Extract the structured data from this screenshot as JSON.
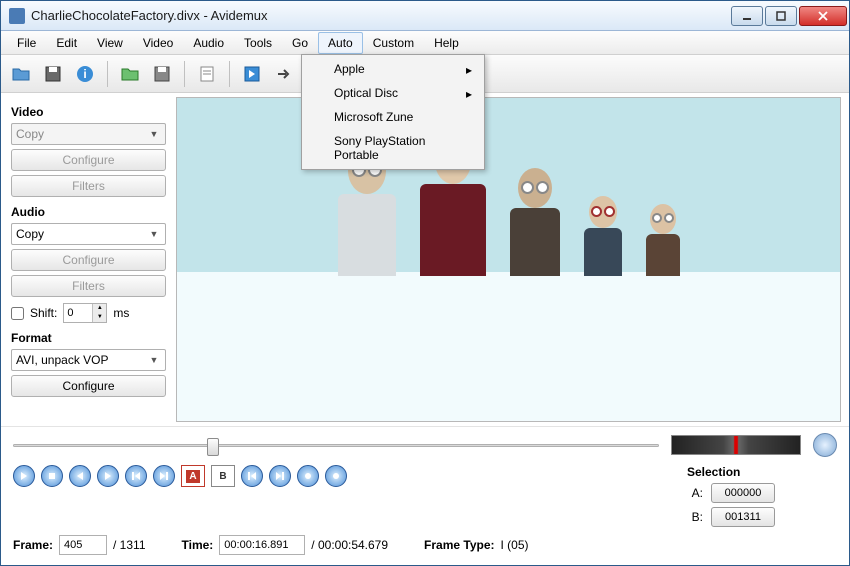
{
  "window": {
    "title": "CharlieChocolateFactory.divx - Avidemux"
  },
  "menu": {
    "items": [
      "File",
      "Edit",
      "View",
      "Video",
      "Audio",
      "Tools",
      "Go",
      "Auto",
      "Custom",
      "Help"
    ],
    "open_index": 7
  },
  "auto_menu": {
    "items": [
      {
        "label": "Apple",
        "submenu": true
      },
      {
        "label": "Optical Disc",
        "submenu": true
      },
      {
        "label": "Microsoft Zune",
        "submenu": false
      },
      {
        "label": "Sony PlayStation Portable",
        "submenu": false
      }
    ]
  },
  "toolbar_icons": [
    "open-file-icon",
    "save-icon",
    "info-icon",
    "open-folder-icon",
    "save-as-icon",
    "properties-icon",
    "selection-icon",
    "arrow-right-icon",
    "box-icon"
  ],
  "sidebar": {
    "video": {
      "label": "Video",
      "codec": "Copy",
      "configure": "Configure",
      "filters": "Filters"
    },
    "audio": {
      "label": "Audio",
      "codec": "Copy",
      "configure": "Configure",
      "filters": "Filters",
      "shift_label": "Shift:",
      "shift_value": "0",
      "shift_unit": "ms"
    },
    "format": {
      "label": "Format",
      "value": "AVI, unpack VOP",
      "configure": "Configure"
    }
  },
  "selection": {
    "label": "Selection",
    "a_label": "A:",
    "a_value": "000000",
    "b_label": "B:",
    "b_value": "001311"
  },
  "status": {
    "frame_label": "Frame:",
    "frame_value": "405",
    "frame_total": "/ 1311",
    "time_label": "Time:",
    "time_value": "00:00:16.891",
    "time_total": "/ 00:00:54.679",
    "frametype_label": "Frame Type:",
    "frametype_value": "I (05)"
  },
  "slider": {
    "position_pct": 30
  }
}
